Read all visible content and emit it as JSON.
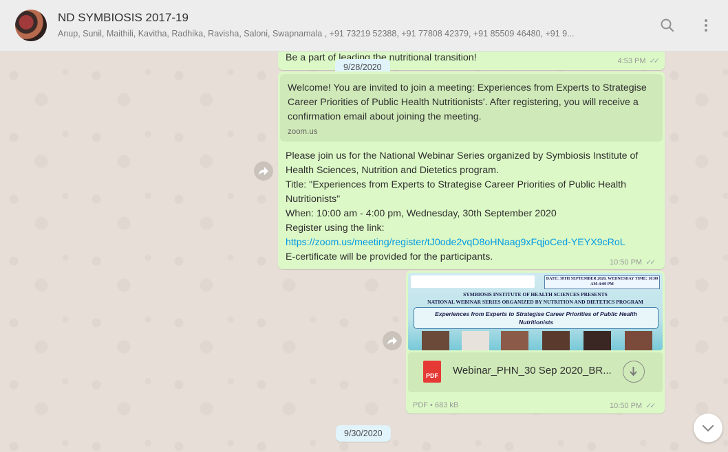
{
  "header": {
    "title": "ND SYMBIOSIS 2017-19",
    "participants": "Anup, Sunil, Maithili, Kavitha, Radhika, Ravisha, Saloni, Swapnamala , +91 73219 52388, +91 77808 42379, +91 85509 46480, +91 9..."
  },
  "date_pills": {
    "first": "9/28/2020",
    "second": "9/30/2020"
  },
  "messages": {
    "m1": {
      "text": "Be a part of leading the nutritional transition!",
      "time": "4:53 PM"
    },
    "preview": {
      "text": "Welcome! You are invited to join a meeting: Experiences from Experts to Strategise Career Priorities of Public Health Nutritionists'. After registering, you will receive a confirmation email about joining the meeting.",
      "domain": "zoom.us"
    },
    "m2": {
      "line1": "Please join us for the National Webinar Series organized by Symbiosis Institute of Health Sciences, Nutrition and Dietetics program.",
      "line2": "Title: \"Experiences from Experts to Strategise Career Priorities of Public Health Nutritionists\"",
      "line3": "When: 10:00 am - 4:00 pm, Wednesday, 30th September 2020",
      "line4": "Register using the link:",
      "link": "https://zoom.us/meeting/register/tJ0ode2vqD8oHNaag9xFqjoCed-YEYX9cRoL",
      "line5": "E-certificate will be provided for the participants.",
      "time": "10:50 PM"
    },
    "m3": {
      "poster": {
        "date_box": "DATE: 30TH SEPTEMBER 2020, WEDNESDAY TIME: 10:00 AM-4:00 PM",
        "line1": "SYMBIOSIS INSTITUTE OF HEALTH SCIENCES PRESENTS",
        "line2": "NATIONAL WEBINAR SERIES ORGANIZED BY NUTRITION AND DIETETICS PROGRAM",
        "heading": "Experiences from Experts to Strategise Career Priorities of Public Health Nutritionists"
      },
      "file_name": "Webinar_PHN_30 Sep 2020_BR...",
      "file_meta": "PDF • 683 kB",
      "pdf_label": "PDF",
      "time": "10:50 PM"
    }
  },
  "icons": {
    "search": "search-icon",
    "menu": "menu-dots-icon",
    "forward": "forward-icon",
    "download": "download-icon",
    "scroll_down": "chevron-down-icon"
  },
  "colors": {
    "bubble": "#dcf8c6",
    "link": "#039be5",
    "pdf": "#e53935",
    "header": "#ededed"
  }
}
